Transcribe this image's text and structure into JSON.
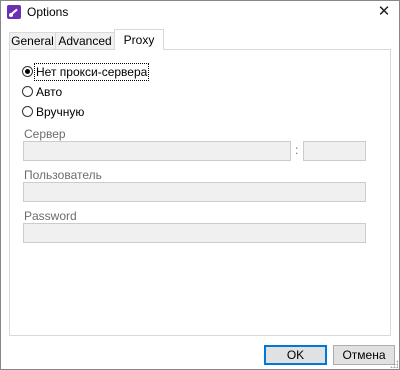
{
  "window": {
    "title": "Options",
    "icon": "app-pen-icon",
    "close_glyph": "✕"
  },
  "tabs": [
    {
      "label": "General",
      "active": false
    },
    {
      "label": "Advanced",
      "active": false
    },
    {
      "label": "Proxy",
      "active": true
    }
  ],
  "proxy": {
    "options": [
      {
        "label": "Нет прокси-сервера",
        "checked": true
      },
      {
        "label": "Авто",
        "checked": false
      },
      {
        "label": "Вручную",
        "checked": false
      }
    ],
    "server": {
      "label": "Сервер",
      "host_value": "",
      "port_separator": ":",
      "port_value": ""
    },
    "user": {
      "label": "Пользователь",
      "value": ""
    },
    "password": {
      "label": "Password",
      "value": ""
    }
  },
  "buttons": {
    "ok": "OK",
    "cancel": "Отмена"
  },
  "colors": {
    "accent": "#0078d7",
    "app_icon": "#6b2fb3",
    "disabled_field": "#f0f0f0",
    "label_gray": "#6d6d6d"
  }
}
